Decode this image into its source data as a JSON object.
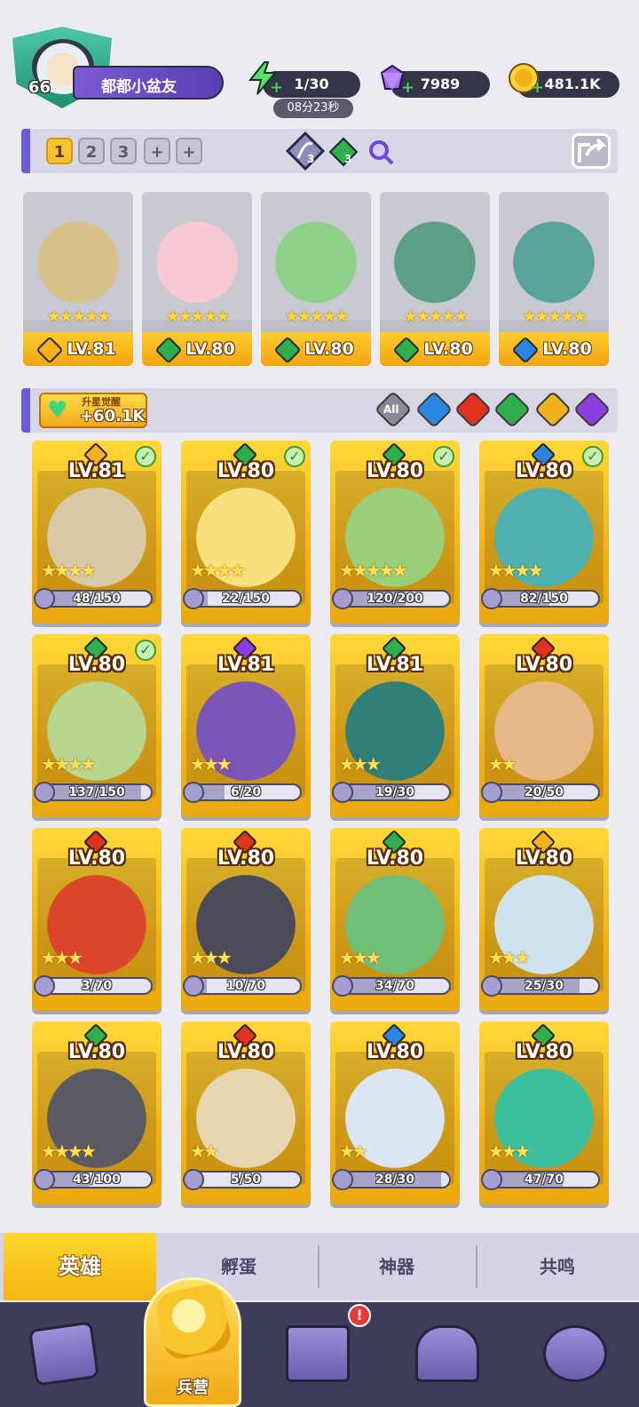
{
  "player": {
    "level": "66",
    "name": "都都小盆友"
  },
  "resources": {
    "energy": "1/30",
    "energy_timer": "08分23秒",
    "gems": "7989",
    "gold": "481.1K"
  },
  "team": {
    "tabs": [
      "1",
      "2",
      "3",
      "+",
      "+"
    ],
    "active_tab": "1",
    "bow_count": "3",
    "nature_count": "3"
  },
  "colors": {
    "light": "#f1b21d",
    "nature": "#2fae4e",
    "water": "#2a86e0",
    "fire": "#e0321e",
    "dark": "#8a3ee0",
    "all": "#8a8a94"
  },
  "team_heroes": [
    {
      "level": "LV.81",
      "element": "light",
      "stars": "★★★★★",
      "art": "#d8c28a"
    },
    {
      "level": "LV.80",
      "element": "nature",
      "stars": "★★★★★",
      "art": "#f6c9d3"
    },
    {
      "level": "LV.80",
      "element": "nature",
      "stars": "★★★★★",
      "art": "#8fd08a"
    },
    {
      "level": "LV.80",
      "element": "nature",
      "stars": "★★★★★",
      "art": "#5b9f86"
    },
    {
      "level": "LV.80",
      "element": "water",
      "stars": "★★★★★",
      "art": "#5aa39a"
    }
  ],
  "awaken": {
    "label": "升星觉醒",
    "value": "+60.1K"
  },
  "filters": {
    "all_label": "All",
    "elements": [
      "water",
      "fire",
      "nature",
      "light",
      "dark"
    ]
  },
  "heroes": [
    {
      "level": "LV.81",
      "element": "light",
      "checked": true,
      "stars": "★★★★",
      "progress": "48/150",
      "fill": 0.32,
      "art": "#d9c9a6"
    },
    {
      "level": "LV.80",
      "element": "nature",
      "checked": true,
      "stars": "★★★★",
      "progress": "22/150",
      "fill": 0.15,
      "art": "#f8e07c"
    },
    {
      "level": "LV.80",
      "element": "nature",
      "checked": true,
      "stars": "★★★★★",
      "progress": "120/200",
      "fill": 0.6,
      "art": "#9ccf7a"
    },
    {
      "level": "LV.80",
      "element": "water",
      "checked": true,
      "stars": "★★★★",
      "progress": "82/150",
      "fill": 0.55,
      "art": "#4fb0b0"
    },
    {
      "level": "LV.80",
      "element": "nature",
      "checked": true,
      "stars": "★★★★",
      "progress": "137/150",
      "fill": 0.91,
      "art": "#b7d68e"
    },
    {
      "level": "LV.81",
      "element": "dark",
      "checked": false,
      "stars": "★★★",
      "progress": "6/20",
      "fill": 0.3,
      "art": "#7b55b8"
    },
    {
      "level": "LV.81",
      "element": "nature",
      "checked": false,
      "stars": "★★★",
      "progress": "19/30",
      "fill": 0.63,
      "art": "#2f7f77"
    },
    {
      "level": "LV.80",
      "element": "fire",
      "checked": false,
      "stars": "★★",
      "progress": "20/50",
      "fill": 0.4,
      "art": "#e6b888"
    },
    {
      "level": "LV.80",
      "element": "fire",
      "checked": false,
      "stars": "★★★",
      "progress": "3/70",
      "fill": 0.04,
      "art": "#d9462a"
    },
    {
      "level": "LV.80",
      "element": "fire",
      "checked": false,
      "stars": "★★★",
      "progress": "10/70",
      "fill": 0.14,
      "art": "#4a4a58"
    },
    {
      "level": "LV.80",
      "element": "nature",
      "checked": false,
      "stars": "★★★",
      "progress": "34/70",
      "fill": 0.49,
      "art": "#6fbf76"
    },
    {
      "level": "LV.80",
      "element": "light",
      "checked": false,
      "stars": "★★★",
      "progress": "25/30",
      "fill": 0.83,
      "art": "#cfe3ef"
    },
    {
      "level": "LV.80",
      "element": "nature",
      "checked": false,
      "stars": "★★★★",
      "progress": "43/100",
      "fill": 0.43,
      "art": "#5a5a62"
    },
    {
      "level": "LV.80",
      "element": "fire",
      "checked": false,
      "stars": "★★",
      "progress": "5/50",
      "fill": 0.1,
      "art": "#e8d6b0"
    },
    {
      "level": "LV.80",
      "element": "water",
      "checked": false,
      "stars": "★★",
      "progress": "28/30",
      "fill": 0.93,
      "art": "#dbe6f5"
    },
    {
      "level": "LV.80",
      "element": "nature",
      "checked": false,
      "stars": "★★★",
      "progress": "47/70",
      "fill": 0.67,
      "art": "#3cbf9d"
    }
  ],
  "subtabs": [
    "英雄",
    "孵蛋",
    "神器",
    "共鸣"
  ],
  "nav": {
    "active_label": "兵营",
    "alert": "!",
    "items": [
      "cards-icon",
      "barracks-icon",
      "map-icon",
      "temple-icon",
      "guild-icon"
    ]
  }
}
